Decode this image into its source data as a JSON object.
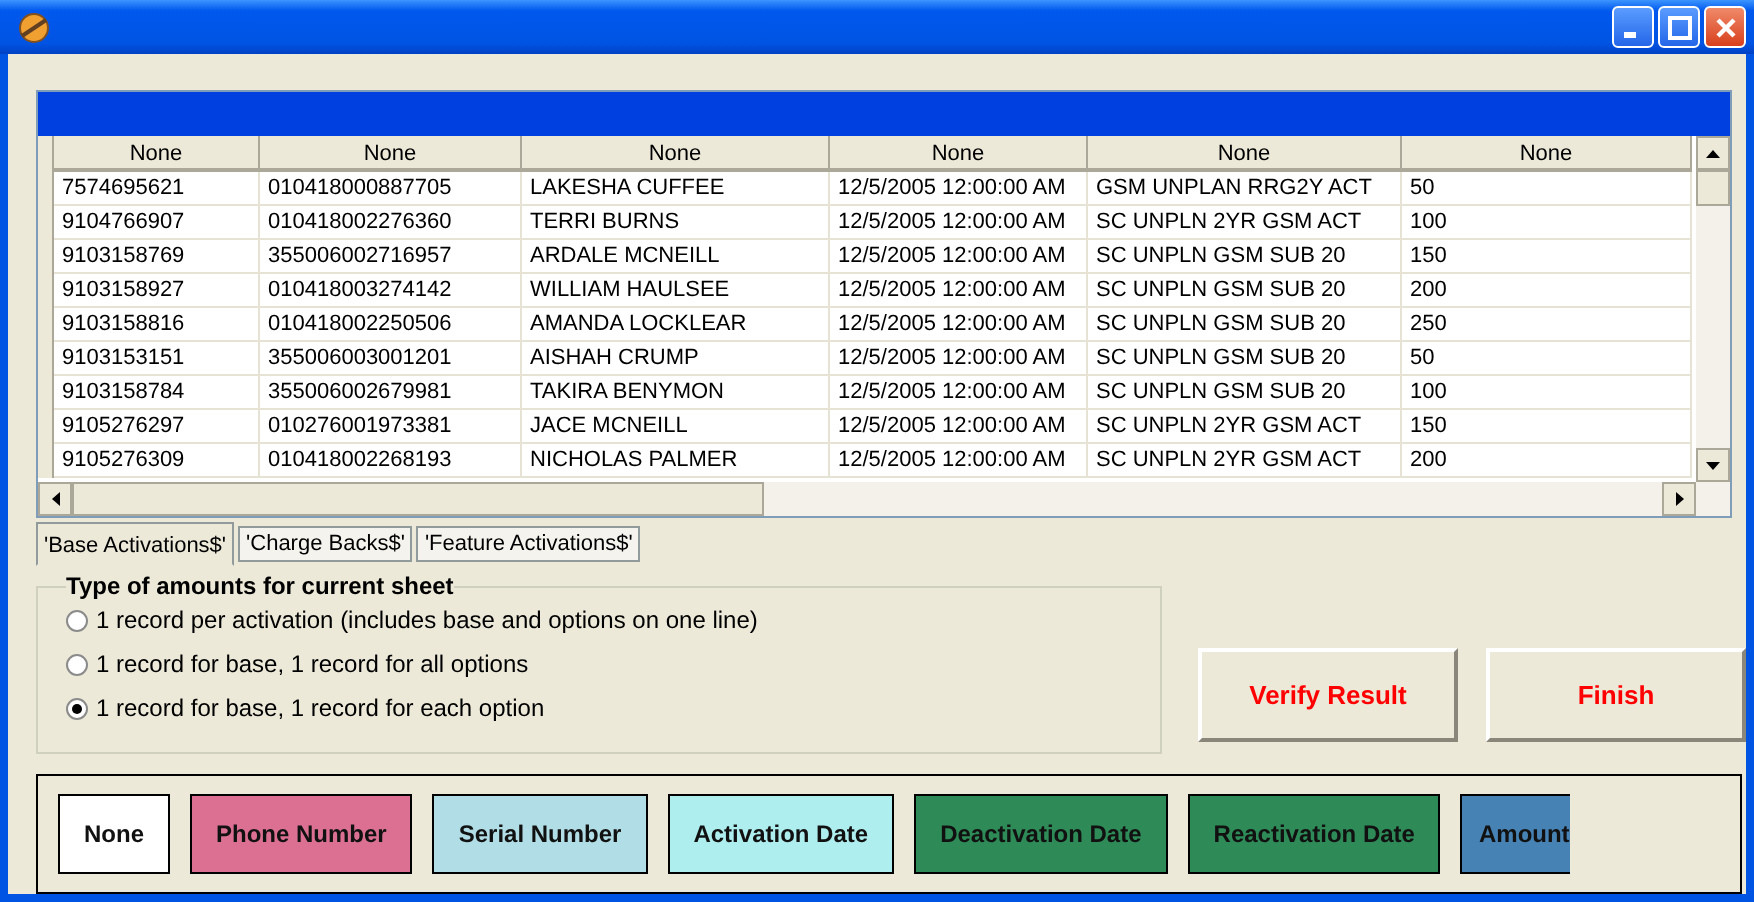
{
  "table": {
    "columns": [
      "None",
      "None",
      "None",
      "None",
      "None",
      "None"
    ],
    "rows": [
      [
        "7574695621",
        "010418000887705",
        "LAKESHA CUFFEE",
        "12/5/2005 12:00:00 AM",
        "GSM UNPLAN RRG2Y ACT",
        "50"
      ],
      [
        "9104766907",
        "010418002276360",
        "TERRI BURNS",
        "12/5/2005 12:00:00 AM",
        "SC UNPLN 2YR GSM ACT",
        "100"
      ],
      [
        "9103158769",
        "355006002716957",
        "ARDALE MCNEILL",
        "12/5/2005 12:00:00 AM",
        "SC UNPLN GSM SUB 20",
        "150"
      ],
      [
        "9103158927",
        "010418003274142",
        "WILLIAM HAULSEE",
        "12/5/2005 12:00:00 AM",
        "SC UNPLN GSM SUB 20",
        "200"
      ],
      [
        "9103158816",
        "010418002250506",
        "AMANDA LOCKLEAR",
        "12/5/2005 12:00:00 AM",
        "SC UNPLN GSM SUB 20",
        "250"
      ],
      [
        "9103153151",
        "355006003001201",
        "AISHAH CRUMP",
        "12/5/2005 12:00:00 AM",
        "SC UNPLN GSM SUB 20",
        "50"
      ],
      [
        "9103158784",
        "355006002679981",
        "TAKIRA BENYMON",
        "12/5/2005 12:00:00 AM",
        "SC UNPLN GSM SUB 20",
        "100"
      ],
      [
        "9105276297",
        "010276001973381",
        "JACE MCNEILL",
        "12/5/2005 12:00:00 AM",
        "SC UNPLN 2YR GSM ACT",
        "150"
      ],
      [
        "9105276309",
        "010418002268193",
        "NICHOLAS PALMER",
        "12/5/2005 12:00:00 AM",
        "SC UNPLN 2YR GSM ACT",
        "200"
      ]
    ]
  },
  "tabs": [
    {
      "label": "'Base Activations$'",
      "selected": true
    },
    {
      "label": "'Charge Backs$'",
      "selected": false
    },
    {
      "label": "'Feature Activations$'",
      "selected": false
    }
  ],
  "amount_type": {
    "title": "Type of amounts for current sheet",
    "options": [
      {
        "label": "1 record per activation (includes base and options on one line)",
        "selected": false
      },
      {
        "label": "1 record for base, 1 record for all options",
        "selected": false
      },
      {
        "label": "1 record for base, 1 record for each option",
        "selected": true
      }
    ]
  },
  "buttons": [
    "Verify Result",
    "Finish"
  ],
  "field_types": [
    {
      "label": "None",
      "color": "#ffffff"
    },
    {
      "label": "Phone Number",
      "color": "#db7093"
    },
    {
      "label": "Serial Number",
      "color": "#b0dde6"
    },
    {
      "label": "Activation Date",
      "color": "#afeeee"
    },
    {
      "label": "Deactivation Date",
      "color": "#2e8b57"
    },
    {
      "label": "Reactivation Date",
      "color": "#2e8b57"
    },
    {
      "label": "Amount",
      "color": "#4682b4"
    }
  ]
}
